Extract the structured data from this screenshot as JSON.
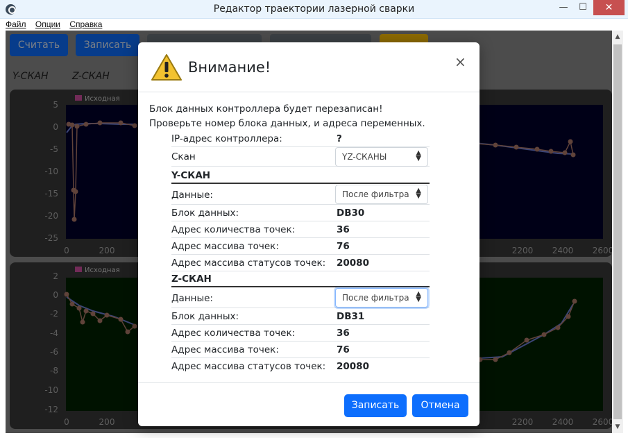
{
  "window": {
    "title": "Редактор траектории лазерной сварки",
    "minimize": "—",
    "maximize": "☐",
    "close": "✕"
  },
  "menu": [
    "Файл",
    "Опции",
    "Справка"
  ],
  "toolbar": {
    "read_label": "Считать",
    "write_label": "Записать"
  },
  "tabs": [
    "Y-СКАН",
    "Z-СКАН"
  ],
  "chart_data": [
    {
      "type": "line",
      "legend": [
        "Исходная"
      ],
      "x_ticks": [
        "0",
        "200",
        "2200",
        "2400",
        "2600"
      ],
      "y_ticks": [
        "5",
        "0",
        "-5",
        "-10",
        "-15",
        "-20",
        "-25"
      ],
      "ylim": [
        -25,
        5
      ],
      "background": "#00002a"
    },
    {
      "type": "line",
      "legend": [
        "Исходная"
      ],
      "x_ticks": [
        "0",
        "200",
        "2200",
        "2400",
        "2600"
      ],
      "y_ticks": [
        "2",
        "0",
        "-2",
        "-4",
        "-6",
        "-8",
        "-10",
        "-12"
      ],
      "ylim": [
        -12,
        2
      ],
      "background": "#002200"
    }
  ],
  "modal": {
    "title": "Внимание!",
    "close": "×",
    "intro_line1": "Блок данных контроллера будет перезаписан!",
    "intro_line2": "Проверьте номер блока данных, и адреса переменных.",
    "ip_label": "IP-адрес контроллера:",
    "ip_value": "?",
    "scan_label": "Скан",
    "scan_value": "YZ-СКАНЫ",
    "y_section": "Y-СКАН",
    "z_section": "Z-СКАН",
    "data_label": "Данные:",
    "filter_value": "После фильтра",
    "block_label": "Блок данных:",
    "count_label": "Адрес количества точек:",
    "array_label": "Адрес массива точек:",
    "status_label": "Адрес массива статусов точек:",
    "y": {
      "block": "DB30",
      "count": "36",
      "array": "76",
      "status": "20080"
    },
    "z": {
      "block": "DB31",
      "count": "36",
      "array": "76",
      "status": "20080"
    },
    "write_button": "Записать",
    "cancel_button": "Отмена"
  },
  "colors": {
    "primary": "#0d6efd",
    "warning": "#ffc107",
    "close_red": "#c75050"
  }
}
